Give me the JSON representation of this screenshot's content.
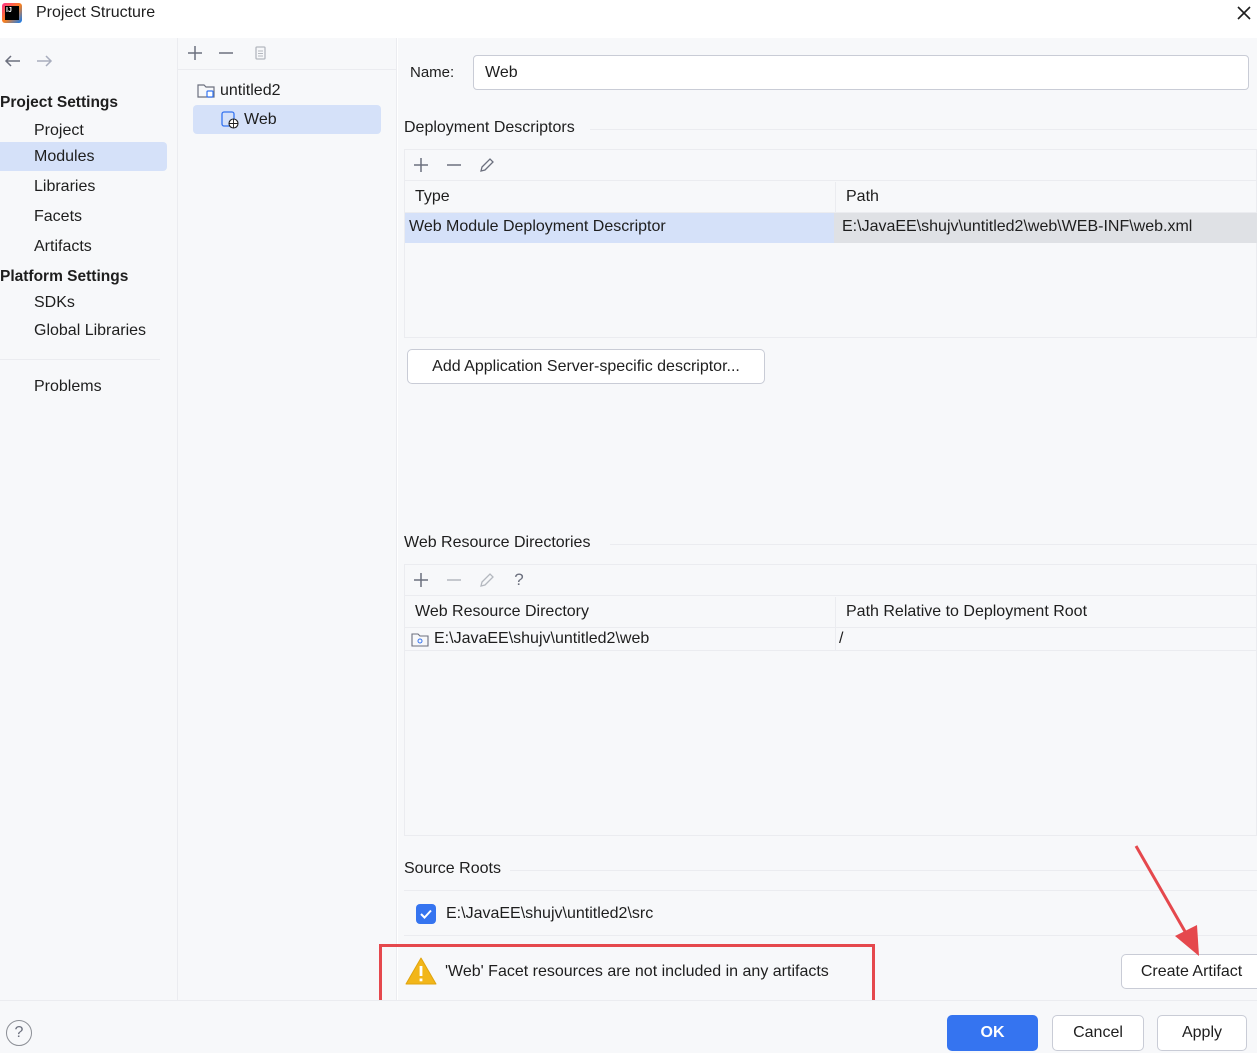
{
  "window": {
    "title": "Project Structure",
    "icons": {
      "app": "intellij-idea-logo",
      "close": "close-icon"
    }
  },
  "sidebar": {
    "nav": {
      "back": "back-arrow-icon",
      "forward": "forward-arrow-icon"
    },
    "project_settings_heading": "Project Settings",
    "project_items": [
      "Project",
      "Modules",
      "Libraries",
      "Facets",
      "Artifacts"
    ],
    "selected_item": "Modules",
    "platform_settings_heading": "Platform Settings",
    "platform_items": [
      "SDKs",
      "Global Libraries"
    ],
    "problems": "Problems"
  },
  "tree": {
    "toolbar_icons": [
      "add-icon",
      "remove-icon",
      "copy-icon"
    ],
    "nodes": [
      {
        "label": "untitled2",
        "icon": "module-folder-icon",
        "level": 0
      },
      {
        "label": "Web",
        "icon": "web-facet-icon",
        "level": 1,
        "selected": true
      }
    ]
  },
  "facet": {
    "name_label": "Name:",
    "name_value": "Web",
    "deployment": {
      "title": "Deployment Descriptors",
      "toolbar_icons": [
        "add-icon",
        "remove-icon",
        "edit-icon"
      ],
      "columns": [
        "Type",
        "Path"
      ],
      "rows": [
        {
          "type": "Web Module Deployment Descriptor",
          "path": "E:\\JavaEE\\shujv\\untitled2\\web\\WEB-INF\\web.xml"
        }
      ],
      "add_server_button": "Add Application Server-specific descriptor..."
    },
    "web_resources": {
      "title": "Web Resource Directories",
      "toolbar_icons": [
        "add-icon",
        "remove-icon",
        "edit-icon",
        "help-icon"
      ],
      "toolbar_help": "?",
      "columns": [
        "Web Resource Directory",
        "Path Relative to Deployment Root"
      ],
      "rows": [
        {
          "directory": "E:\\JavaEE\\shujv\\untitled2\\web",
          "relative": "/"
        }
      ]
    },
    "source_roots": {
      "title": "Source Roots",
      "items": [
        {
          "path": "E:\\JavaEE\\shujv\\untitled2\\src",
          "checked": true
        }
      ]
    },
    "warning": {
      "icon": "warning-icon",
      "text": "'Web' Facet resources are not included in any artifacts"
    },
    "create_artifact_button": "Create Artifact"
  },
  "footer": {
    "help": "?",
    "ok": "OK",
    "cancel": "Cancel",
    "apply": "Apply"
  },
  "colors": {
    "accent": "#3574f0",
    "selection": "#d5e1f9",
    "panel_bg": "#f7f8fa",
    "warning": "#f2b619",
    "annotation_red": "#e5484d"
  }
}
